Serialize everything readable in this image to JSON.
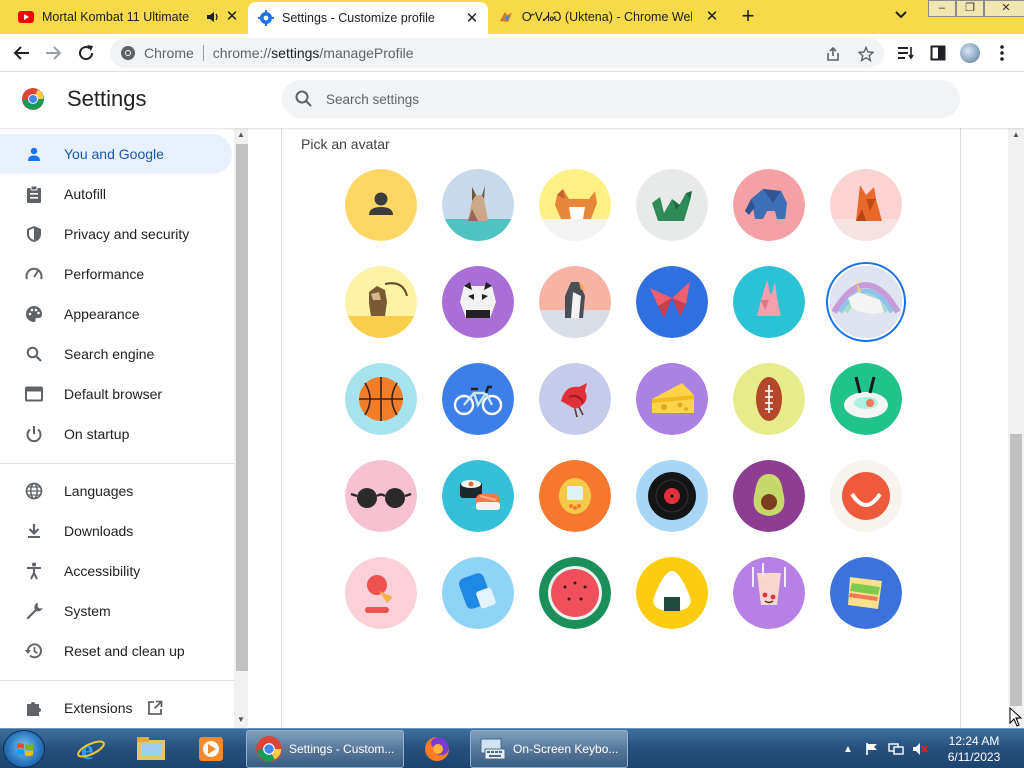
{
  "tabs": [
    {
      "title": "Mortal Kombat 11 Ultimate",
      "favicon": "youtube-icon",
      "audio": true
    },
    {
      "title": "Settings - Customize profile",
      "favicon": "settings-gear-icon",
      "active": true
    },
    {
      "title": "ᏅᏙᏗᏍ (Uktena) - Chrome Web S",
      "favicon": "chrome-web-store-icon"
    }
  ],
  "toolbar": {
    "omnibox_chip": "Chrome",
    "url_prefix": "chrome://",
    "url_host": "settings",
    "url_path": "/manageProfile"
  },
  "settings": {
    "title": "Settings",
    "search_placeholder": "Search settings"
  },
  "sidebar": {
    "items": [
      {
        "label": "You and Google",
        "icon": "person-icon",
        "selected": true
      },
      {
        "label": "Autofill",
        "icon": "clipboard-icon"
      },
      {
        "label": "Privacy and security",
        "icon": "shield-icon"
      },
      {
        "label": "Performance",
        "icon": "speedometer-icon"
      },
      {
        "label": "Appearance",
        "icon": "palette-icon"
      },
      {
        "label": "Search engine",
        "icon": "search-icon"
      },
      {
        "label": "Default browser",
        "icon": "browser-window-icon"
      },
      {
        "label": "On startup",
        "icon": "power-icon"
      },
      {
        "label": "Languages",
        "icon": "globe-icon"
      },
      {
        "label": "Downloads",
        "icon": "download-icon"
      },
      {
        "label": "Accessibility",
        "icon": "accessibility-icon"
      },
      {
        "label": "System",
        "icon": "wrench-icon"
      },
      {
        "label": "Reset and clean up",
        "icon": "history-icon"
      },
      {
        "label": "Extensions",
        "icon": "puzzle-icon"
      }
    ]
  },
  "main": {
    "pick_label": "Pick an avatar",
    "avatars": [
      "generic-person",
      "origami-cat",
      "origami-corgi",
      "origami-dragon",
      "origami-elephant",
      "origami-fox",
      "origami-monkey",
      "origami-panda",
      "origami-penguin",
      "origami-butterfly",
      "origami-rabbit",
      "origami-unicorn",
      "basketball",
      "bicycle",
      "bird",
      "cheese",
      "football",
      "sushi-plate",
      "sunglasses",
      "sushi-rolls",
      "tamagotchi",
      "vinyl-record",
      "avocado",
      "smiley-face",
      "ice-cream",
      "popsicle",
      "watermelon",
      "onigiri",
      "pizza",
      "sandwich"
    ],
    "selected_avatar": "origami-unicorn"
  },
  "taskbar": {
    "tasks": [
      {
        "label": "Settings - Custom...",
        "icon": "chrome-icon"
      },
      {
        "label": "On-Screen Keybo...",
        "icon": "keyboard-icon"
      }
    ],
    "time": "12:24 AM",
    "date": "6/11/2023"
  },
  "colors": {
    "tabstrip": "#f6da4a",
    "accent": "#1a73e8",
    "selected_nav_bg": "#e8f0fe"
  }
}
